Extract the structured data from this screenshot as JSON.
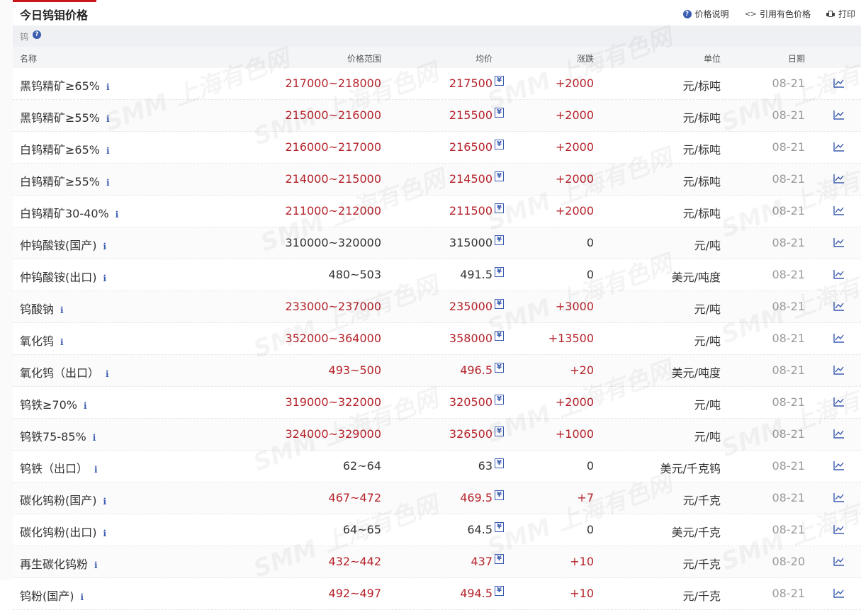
{
  "header": {
    "title": "今日钨钼价格",
    "actions": [
      {
        "label": "价格说明",
        "icon": "question-circle-icon"
      },
      {
        "label": "引用有色价格",
        "icon": "code-icon"
      },
      {
        "label": "打印",
        "icon": "printer-icon"
      }
    ]
  },
  "section": {
    "label": "钨",
    "help_icon": "?"
  },
  "columns": {
    "name": "名称",
    "range": "价格范围",
    "avg": "均价",
    "change": "涨跌",
    "unit": "单位",
    "date": "日期"
  },
  "info_mark": "i",
  "currency_mark": "¥",
  "watermark_text": "SMM 上海有色网",
  "colors": {
    "accent": "#c9161d",
    "up": "#b5222a",
    "link": "#3a5bb0"
  },
  "rows": [
    {
      "name": "黑钨精矿≥65%",
      "range": "217000~218000",
      "avg": "217500",
      "change": "+2000",
      "unit": "元/标吨",
      "date": "08-21",
      "trend": "up"
    },
    {
      "name": "黑钨精矿≥55%",
      "range": "215000~216000",
      "avg": "215500",
      "change": "+2000",
      "unit": "元/标吨",
      "date": "08-21",
      "trend": "up"
    },
    {
      "name": "白钨精矿≥65%",
      "range": "216000~217000",
      "avg": "216500",
      "change": "+2000",
      "unit": "元/标吨",
      "date": "08-21",
      "trend": "up"
    },
    {
      "name": "白钨精矿≥55%",
      "range": "214000~215000",
      "avg": "214500",
      "change": "+2000",
      "unit": "元/标吨",
      "date": "08-21",
      "trend": "up"
    },
    {
      "name": "白钨精矿30-40%",
      "range": "211000~212000",
      "avg": "211500",
      "change": "+2000",
      "unit": "元/标吨",
      "date": "08-21",
      "trend": "up"
    },
    {
      "name": "仲钨酸铵(国产)",
      "range": "310000~320000",
      "avg": "315000",
      "change": "0",
      "unit": "元/吨",
      "date": "08-21",
      "trend": "flat"
    },
    {
      "name": "仲钨酸铵(出口)",
      "range": "480~503",
      "avg": "491.5",
      "change": "0",
      "unit": "美元/吨度",
      "date": "08-21",
      "trend": "flat"
    },
    {
      "name": "钨酸钠",
      "range": "233000~237000",
      "avg": "235000",
      "change": "+3000",
      "unit": "元/吨",
      "date": "08-21",
      "trend": "up"
    },
    {
      "name": "氧化钨",
      "range": "352000~364000",
      "avg": "358000",
      "change": "+13500",
      "unit": "元/吨",
      "date": "08-21",
      "trend": "up"
    },
    {
      "name": "氧化钨（出口）",
      "range": "493~500",
      "avg": "496.5",
      "change": "+20",
      "unit": "美元/吨度",
      "date": "08-21",
      "trend": "up"
    },
    {
      "name": "钨铁≥70%",
      "range": "319000~322000",
      "avg": "320500",
      "change": "+2000",
      "unit": "元/吨",
      "date": "08-21",
      "trend": "up"
    },
    {
      "name": "钨铁75-85%",
      "range": "324000~329000",
      "avg": "326500",
      "change": "+1000",
      "unit": "元/吨",
      "date": "08-21",
      "trend": "up"
    },
    {
      "name": "钨铁（出口）",
      "range": "62~64",
      "avg": "63",
      "change": "0",
      "unit": "美元/千克钨",
      "date": "08-21",
      "trend": "flat"
    },
    {
      "name": "碳化钨粉(国产)",
      "range": "467~472",
      "avg": "469.5",
      "change": "+7",
      "unit": "元/千克",
      "date": "08-21",
      "trend": "up"
    },
    {
      "name": "碳化钨粉(出口)",
      "range": "64~65",
      "avg": "64.5",
      "change": "0",
      "unit": "美元/千克",
      "date": "08-21",
      "trend": "flat"
    },
    {
      "name": "再生碳化钨粉",
      "range": "432~442",
      "avg": "437",
      "change": "+10",
      "unit": "元/千克",
      "date": "08-20",
      "trend": "up"
    },
    {
      "name": "钨粉(国产)",
      "range": "492~497",
      "avg": "494.5",
      "change": "+10",
      "unit": "元/千克",
      "date": "08-21",
      "trend": "up"
    }
  ]
}
